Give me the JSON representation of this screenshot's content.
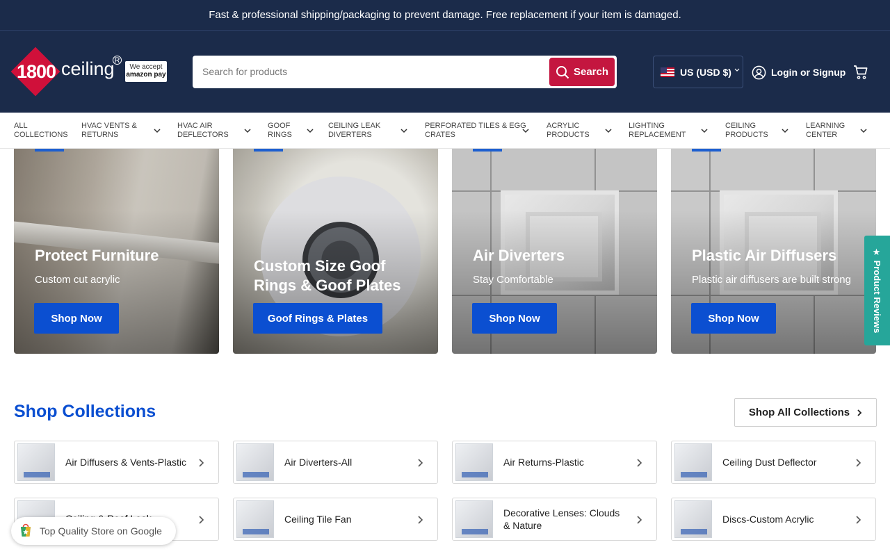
{
  "announcement": "Fast & professional shipping/packaging to prevent damage. Free replacement if your item is damaged.",
  "brand": {
    "logo_number": "1800",
    "logo_word": "ceiling",
    "amazon_line1": "We accept",
    "amazon_line2": "amazon pay"
  },
  "search": {
    "placeholder": "Search for products",
    "button": "Search"
  },
  "currency": "US (USD $)",
  "login": "Login or Signup",
  "nav": [
    {
      "label": "ALL COLLECTIONS",
      "l1": "ALL",
      "l2": "COLLECTIONS",
      "dropdown": false
    },
    {
      "label": "HVAC VENTS & RETURNS",
      "l1": "HVAC VENTS &",
      "l2": "RETURNS",
      "dropdown": true
    },
    {
      "label": "HVAC AIR DEFLECTORS",
      "l1": "HVAC AIR",
      "l2": "DEFLECTORS",
      "dropdown": true
    },
    {
      "label": "GOOF RINGS",
      "l1": "GOOF",
      "l2": "RINGS",
      "dropdown": true
    },
    {
      "label": "CEILING LEAK DIVERTERS",
      "l1": "CEILING LEAK",
      "l2": "DIVERTERS",
      "dropdown": true
    },
    {
      "label": "PERFORATED TILES & EGG CRATES",
      "l1": "PERFORATED TILES & EGG",
      "l2": "CRATES",
      "dropdown": true
    },
    {
      "label": "ACRYLIC PRODUCTS",
      "l1": "ACRYLIC",
      "l2": "PRODUCTS",
      "dropdown": true
    },
    {
      "label": "LIGHTING REPLACEMENT",
      "l1": "LIGHTING",
      "l2": "REPLACEMENT",
      "dropdown": true
    },
    {
      "label": "CEILING PRODUCTS",
      "l1": "CEILING",
      "l2": "PRODUCTS",
      "dropdown": true
    },
    {
      "label": "LEARNING CENTER",
      "l1": "LEARNING",
      "l2": "CENTER",
      "dropdown": true
    }
  ],
  "promos": [
    {
      "title": "Protect Furniture",
      "subtitle": "Custom cut acrylic",
      "button": "Shop Now"
    },
    {
      "title": "Custom Size Goof Rings & Goof Plates",
      "subtitle": "",
      "button": "Goof Rings & Plates"
    },
    {
      "title": "Air Diverters",
      "subtitle": "Stay Comfortable",
      "button": "Shop Now"
    },
    {
      "title": "Plastic Air Diffusers",
      "subtitle": "Plastic air diffusers are built strong",
      "button": "Shop Now"
    }
  ],
  "collections_section": {
    "title": "Shop Collections",
    "all_button": "Shop All Collections"
  },
  "collections": [
    {
      "label": "Air Diffusers & Vents-Plastic"
    },
    {
      "label": "Air Diverters-All"
    },
    {
      "label": "Air Returns-Plastic"
    },
    {
      "label": "Ceiling Dust Deflector"
    },
    {
      "label": "Ceiling & Roof Leak"
    },
    {
      "label": "Ceiling Tile Fan"
    },
    {
      "label": "Decorative Lenses: Clouds & Nature"
    },
    {
      "label": "Discs-Custom Acrylic"
    }
  ],
  "reviews_tab": "★ Product Reviews",
  "google_badge": "Top Quality Store on Google",
  "colors": {
    "header_bg": "#1b2b4a",
    "search_button": "#c4163f",
    "primary_button": "#0b4fd1",
    "reviews_tab": "#26a69a"
  }
}
